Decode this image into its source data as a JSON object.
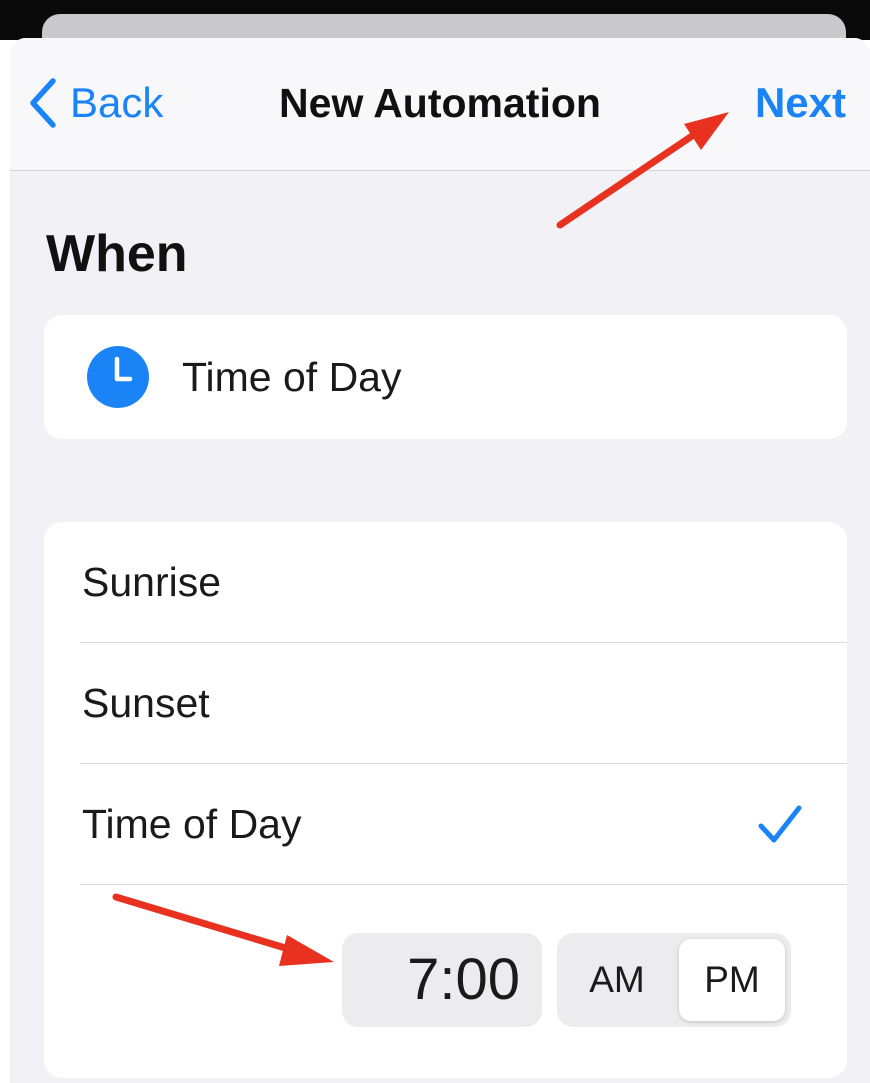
{
  "navbar": {
    "back_label": "Back",
    "title": "New Automation",
    "next_label": "Next"
  },
  "section": {
    "heading": "When"
  },
  "trigger": {
    "icon": "clock-icon",
    "label": "Time of Day"
  },
  "options": {
    "items": [
      {
        "label": "Sunrise",
        "selected": false
      },
      {
        "label": "Sunset",
        "selected": false
      },
      {
        "label": "Time of Day",
        "selected": true
      }
    ]
  },
  "time_picker": {
    "time": "7:00",
    "am_label": "AM",
    "pm_label": "PM",
    "selected_period": "PM"
  },
  "colors": {
    "accent": "#1a84f7",
    "annotation_arrow": "#e8311f",
    "background": "#f1f1f6"
  },
  "icons": {
    "back": "chevron-left-icon",
    "check": "checkmark-icon"
  }
}
